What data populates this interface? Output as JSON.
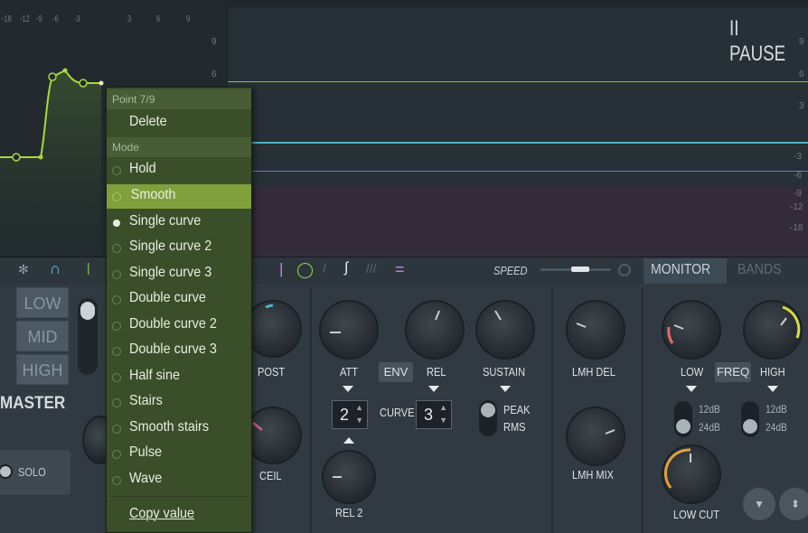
{
  "graph": {
    "top_scale": [
      "-18",
      "-12",
      "-9",
      "-6",
      "-3",
      "3",
      "6",
      "9"
    ],
    "right_labels": [
      "9",
      "6",
      "3",
      "-3",
      "-6",
      "-9",
      "-12",
      "-18"
    ],
    "left_mid_labels": [
      "9",
      "6"
    ],
    "pause_label": "II PAUSE"
  },
  "toolbar": {
    "speed_label": "SPEED",
    "tabs": {
      "monitor": "MONITOR",
      "bands": "BANDS"
    }
  },
  "bands": {
    "low": "LOW",
    "mid": "MID",
    "high": "HIGH",
    "master": "MASTER",
    "solo": "SOLO"
  },
  "controls": {
    "post": "POST",
    "ceil": "CEIL",
    "att": "ATT",
    "env": "ENV",
    "rel": "REL",
    "sustain": "SUSTAIN",
    "curve_label": "CURVE",
    "curve_left_value": "2",
    "curve_right_value": "3",
    "rel2": "REL 2",
    "peak": "PEAK",
    "rms": "RMS",
    "lmh_del": "LMH DEL",
    "lmh_mix": "LMH MIX"
  },
  "monitor": {
    "low": "LOW",
    "freq": "FREQ",
    "high": "HIGH",
    "db12_a": "12dB",
    "db24_a": "24dB",
    "db12_b": "12dB",
    "db24_b": "24dB",
    "low_cut": "LOW CUT"
  },
  "menu": {
    "point_header": "Point 7/9",
    "delete": "Delete",
    "mode_header": "Mode",
    "items": [
      "Hold",
      "Smooth",
      "Single curve",
      "Single curve 2",
      "Single curve 3",
      "Double curve",
      "Double curve 2",
      "Double curve 3",
      "Half sine",
      "Stairs",
      "Smooth stairs",
      "Pulse",
      "Wave"
    ],
    "highlighted": "Smooth",
    "checked": "Single curve",
    "copy_value": "Copy value"
  },
  "colors": {
    "curve": "#a6d93a",
    "menu_bg": "#3b4e2a",
    "menu_highlight": "#7fa03c",
    "line_cyan": "#4fb3c9",
    "line_purple": "#7b6fc4"
  }
}
